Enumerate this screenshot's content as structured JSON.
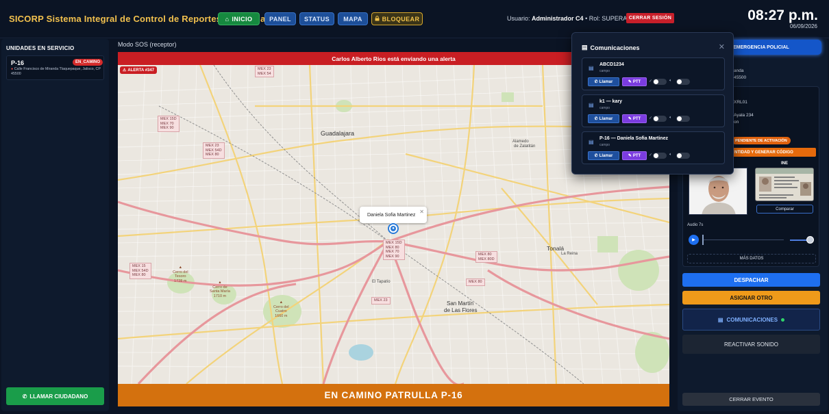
{
  "header": {
    "brand": "SICORP Sistema Integral de Control de Reportes y Patrullaje",
    "nav": [
      {
        "label": "INICIO",
        "icon": "home-icon"
      },
      {
        "label": "PANEL"
      },
      {
        "label": "STATUS"
      },
      {
        "label": "MAPA"
      },
      {
        "label": "BLOQUEAR",
        "icon": "lock-icon"
      }
    ],
    "user_prefix": "Usuario:",
    "user_name": "Administrador C4",
    "role_text": "• Rol: SUPERADMIN",
    "logout": "CERRAR SESIÓN",
    "time": "08:27 p.m.",
    "date": "06/09/2026"
  },
  "left": {
    "title": "UNIDADES EN SERVICIO",
    "unit": {
      "code": "P-16",
      "status": "EN_CAMINO",
      "address": "Calle Francisco de Miranda Tlaquepaque, Jalisco, CP 45500"
    },
    "call_button": "LLAMAR CIUDADANO"
  },
  "center": {
    "mode": "Modo SOS (receptor)",
    "alert_banner": "Carlos Alberto Rios está enviando una alerta",
    "alert_tag": "ALERTA #347",
    "popup_name": "Daniela Sofia Martinez",
    "bottom_banner": "EN CAMINO PATRULLA P-16",
    "map_labels": {
      "guadalajara": "Guadalajara",
      "tonala": "Tonalá",
      "sanmartin1": "San Martín",
      "sanmartin2": "de Las Flores",
      "eltapatio": "El Tapatío",
      "alamedo": "Alamedo",
      "zalatitan": "de Zalatitán",
      "colonia_reina": "La Reina"
    },
    "highways": [
      {
        "text": "MEX 23\nMEX 54"
      },
      {
        "text": "MEX 15D\nMEX 70\nMEX 90"
      },
      {
        "text": "MEX 23\nMEX 54D\nMEX 80"
      },
      {
        "text": "MEX 15D\nMEX 80\nMEX 70\nMEX 90"
      },
      {
        "text": "MEX 15\nMEX 54D\nMEX 80"
      },
      {
        "text": "MEX 80\nMEX 80D"
      },
      {
        "text": "MEX 80"
      },
      {
        "text": "MEX 23"
      }
    ],
    "peaks": [
      {
        "text": "Cerro del\nTesoro\n1728 m"
      },
      {
        "text": "Cerro de\nSanta María\n1710 m"
      },
      {
        "text": "Cerro del\nCuatro\n1660 m"
      }
    ]
  },
  "right": {
    "emergency": "EMERGENCIA POLICIAL",
    "partial_texts": [
      "anda",
      "45500",
      "XRL01",
      "Ayala 234",
      "on"
    ],
    "pending": "PENDIENTE DE ACTIVACIÓN",
    "verify": "NTIDAD Y GENERAR CÓDIGO",
    "ine_label": "INE",
    "compare": "Comparar",
    "audio_label": "Audio 7s",
    "more_data": "MÁS DATOS",
    "dispatch": "DESPACHAR",
    "assign": "ASIGNAR OTRO",
    "comms": "COMUNICACIONES",
    "reactivate": "REACTIVAR SONIDO",
    "close_event": "CERRAR EVENTO"
  },
  "comms_panel": {
    "title": "Comunicaciones",
    "contacts": [
      {
        "name": "ABCD1234",
        "sub": "campo"
      },
      {
        "name": "k1 — kary",
        "sub": "campo"
      },
      {
        "name": "P-16 — Daniela Sofia Martinez",
        "sub": "campo"
      }
    ],
    "call_label": "Llamar",
    "ptt_label": "PTT"
  },
  "colors": {
    "background": "#0b1424",
    "panel": "#0e1a2d",
    "alert_red": "#c91e23",
    "orange": "#d4710e",
    "blue": "#1e6ff0",
    "green": "#1a9d4a",
    "gold": "#f2c14e",
    "ptt_purple": "#7b3ce0"
  }
}
